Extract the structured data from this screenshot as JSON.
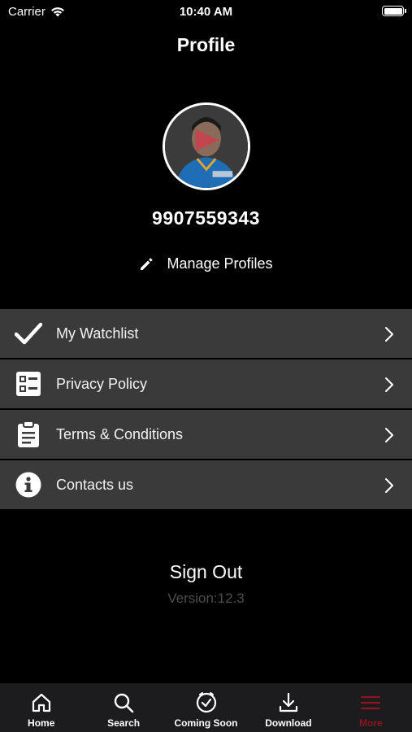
{
  "status_bar": {
    "carrier": "Carrier",
    "time": "10:40 AM"
  },
  "header": {
    "title": "Profile"
  },
  "profile": {
    "phone": "9907559343",
    "manage_label": "Manage Profiles"
  },
  "menu": [
    {
      "label": "My Watchlist",
      "icon": "check-icon"
    },
    {
      "label": "Privacy Policy",
      "icon": "list-icon"
    },
    {
      "label": "Terms & Conditions",
      "icon": "clipboard-icon"
    },
    {
      "label": "Contacts us",
      "icon": "info-icon"
    }
  ],
  "footer": {
    "signout_label": "Sign Out",
    "version": "Version:12.3"
  },
  "tabs": [
    {
      "label": "Home",
      "icon": "home-icon"
    },
    {
      "label": "Search",
      "icon": "search-icon"
    },
    {
      "label": "Coming Soon",
      "icon": "clock-icon"
    },
    {
      "label": "Download",
      "icon": "download-icon"
    },
    {
      "label": "More",
      "icon": "menu-icon",
      "active": true
    }
  ],
  "colors": {
    "background": "#000000",
    "menu_row": "#3a3a3a",
    "tabbar": "#1c1c1e",
    "accent": "#8b1520",
    "version_text": "#4d4d4d"
  }
}
